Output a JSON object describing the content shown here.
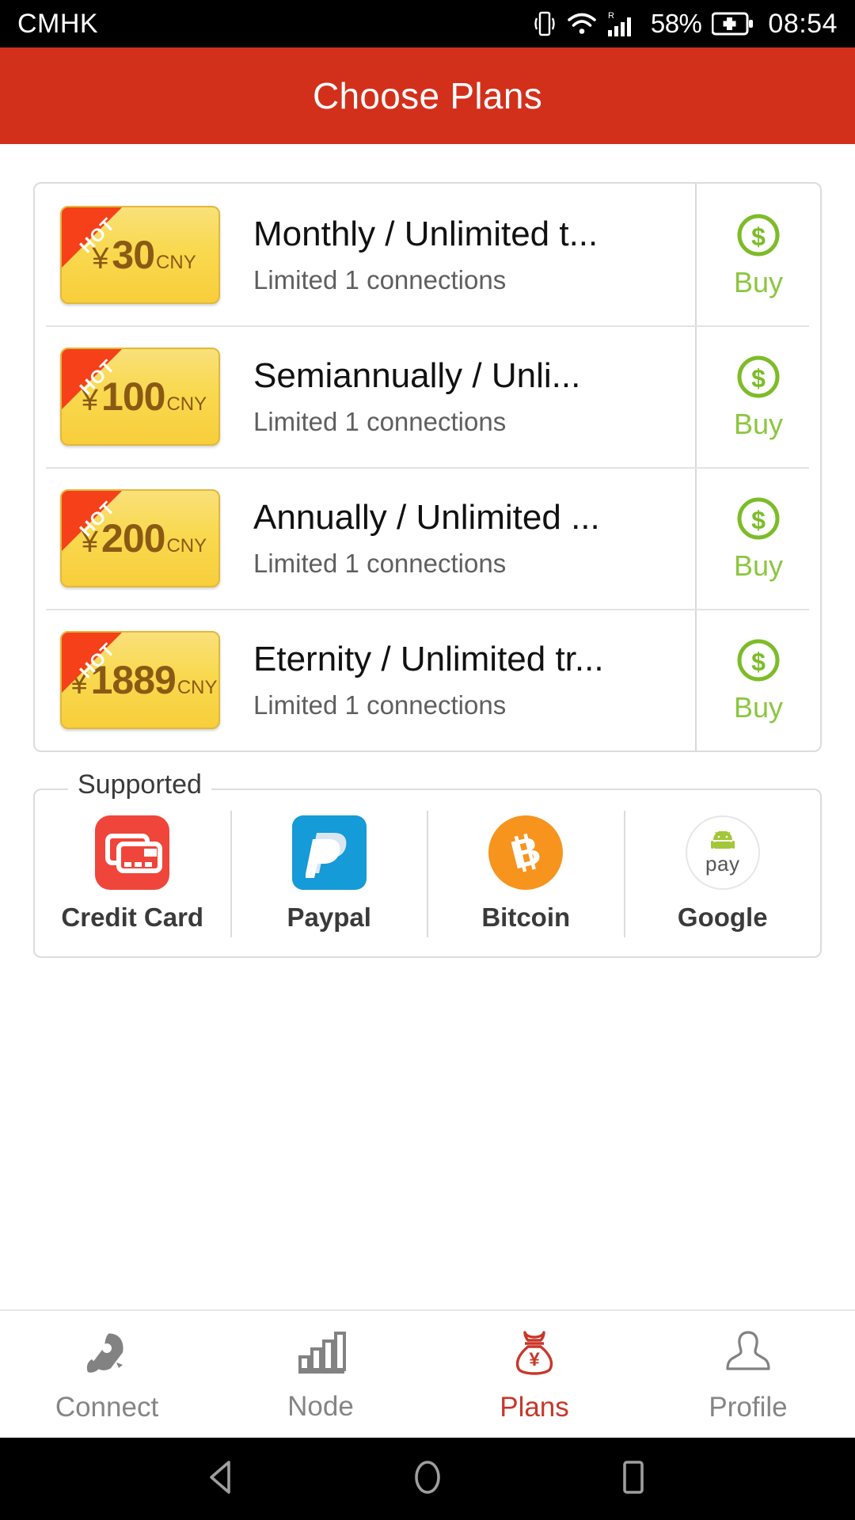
{
  "statusbar": {
    "carrier": "CMHK",
    "battery_percent": "58%",
    "clock": "08:54",
    "roaming_mark": "R",
    "icons": [
      "vibrate-icon",
      "wifi-icon",
      "cellular-signal-icon",
      "battery-charging-icon"
    ]
  },
  "header": {
    "title": "Choose Plans",
    "background_color": "#D3301C",
    "text_color": "#FFFFFF"
  },
  "plans": {
    "badge_label": "HOT",
    "currency_symbol": "¥",
    "currency_code": "CNY",
    "buy_label": "Buy",
    "buy_color": "#8CC63F",
    "items": [
      {
        "price": "30",
        "title": "Monthly / Unlimited t...",
        "subtitle": "Limited 1 connections",
        "hot": "HOT",
        "buy": "Buy"
      },
      {
        "price": "100",
        "title": "Semiannually / Unli...",
        "subtitle": "Limited 1 connections",
        "hot": "HOT",
        "buy": "Buy"
      },
      {
        "price": "200",
        "title": "Annually / Unlimited ...",
        "subtitle": "Limited 1 connections",
        "hot": "HOT",
        "buy": "Buy"
      },
      {
        "price": "1889",
        "title": "Eternity / Unlimited tr...",
        "subtitle": "Limited 1 connections",
        "hot": "HOT",
        "buy": "Buy"
      }
    ]
  },
  "supported": {
    "legend": "Supported",
    "methods": [
      {
        "label": "Credit Card",
        "icon": "credit-card-icon",
        "color": "#F0453A"
      },
      {
        "label": "Paypal",
        "icon": "paypal-icon",
        "color": "#159BD7"
      },
      {
        "label": "Bitcoin",
        "icon": "bitcoin-icon",
        "color": "#F7941E"
      },
      {
        "label": "Google",
        "icon": "google-pay-icon",
        "color": "#A4C639",
        "sub": "pay"
      }
    ]
  },
  "tabbar": {
    "active_color": "#C8372A",
    "inactive_color": "#858585",
    "tabs": [
      {
        "label": "Connect",
        "icon": "rocket-icon",
        "active": false
      },
      {
        "label": "Node",
        "icon": "bar-chart-icon",
        "active": false
      },
      {
        "label": "Plans",
        "icon": "money-bag-icon",
        "active": true
      },
      {
        "label": "Profile",
        "icon": "person-icon",
        "active": false
      }
    ]
  },
  "navbar": {
    "buttons": [
      "back-triangle-icon",
      "home-circle-icon",
      "recents-square-icon"
    ]
  }
}
